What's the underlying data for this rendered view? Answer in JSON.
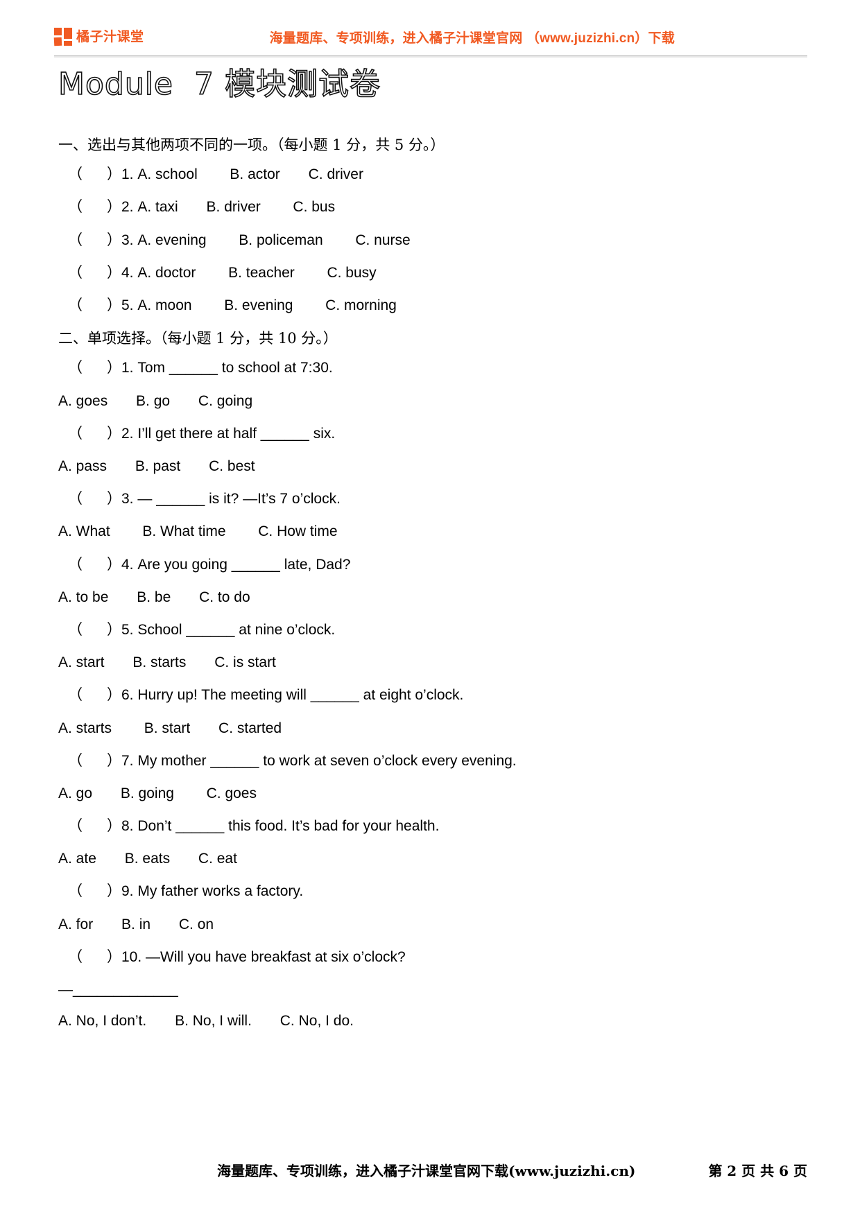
{
  "header": {
    "logo_text": "橘子汁课堂",
    "logo_icon": "orange-squares-logo-icon",
    "slogan": "海量题库、专项训练，进入橘子汁课堂官网 （www.juzizhi.cn）下载",
    "brand_color": "#F15A22"
  },
  "title": "Module  7 模块测试卷",
  "sections": [
    {
      "heading": "一、选出与其他两项不同的一项。（每小题 1 分，共 5 分。）",
      "lines": [
        {
          "type": "question",
          "text": "（      ）1. A. school        B. actor       C. driver"
        },
        {
          "type": "question",
          "text": "（      ）2. A. taxi       B. driver        C. bus"
        },
        {
          "type": "question",
          "text": "（      ）3. A. evening        B. policeman        C. nurse"
        },
        {
          "type": "question",
          "text": "（      ）4. A. doctor        B. teacher        C. busy"
        },
        {
          "type": "question",
          "text": "（      ）5. A. moon        B. evening        C. morning"
        }
      ]
    },
    {
      "heading": "二、单项选择。（每小题 1 分，共 10 分。）",
      "lines": [
        {
          "type": "question",
          "text": "（      ）1. Tom ______ to school at 7:30."
        },
        {
          "type": "options",
          "text": "A. goes       B. go       C. going"
        },
        {
          "type": "question",
          "text": "（      ）2. I’ll get there at half ______ six."
        },
        {
          "type": "options",
          "text": "A. pass       B. past       C. best"
        },
        {
          "type": "question",
          "text": "（      ）3. — ______ is it? —It’s 7 o’clock."
        },
        {
          "type": "options",
          "text": "A. What        B. What time        C. How time"
        },
        {
          "type": "question",
          "text": "（      ）4. Are you going ______ late, Dad?"
        },
        {
          "type": "options",
          "text": "A. to be       B. be       C. to do"
        },
        {
          "type": "question",
          "text": "（      ）5. School ______ at nine o’clock."
        },
        {
          "type": "options",
          "text": "A. start       B. starts       C. is start"
        },
        {
          "type": "question",
          "text": "（      ）6. Hurry up! The meeting will ______ at eight o’clock."
        },
        {
          "type": "options",
          "text": "A. starts        B. start       C. started"
        },
        {
          "type": "question",
          "text": "（      ）7. My mother ______ to work at seven o’clock every evening."
        },
        {
          "type": "options",
          "text": "A. go       B. going        C. goes"
        },
        {
          "type": "question",
          "text": "（      ）8. Don’t ______ this food. It’s bad for your health."
        },
        {
          "type": "options",
          "text": "A. ate       B. eats       C. eat"
        },
        {
          "type": "question",
          "text": "（      ）9. My father works a factory."
        },
        {
          "type": "options",
          "text": "A. for       B. in       C. on"
        },
        {
          "type": "question",
          "text": "（      ）10. —Will you have breakfast at six o’clock?"
        },
        {
          "type": "tail",
          "text": "—_____________"
        },
        {
          "type": "options",
          "text": "A. No, I don’t.       B. No, I will.       C. No, I do."
        }
      ]
    }
  ],
  "footer": {
    "center_text": "海量题库、专项训练，进入橘子汁课堂官网下载(www.juzizhi.cn)",
    "page_text": "第 2 页 共 6 页"
  }
}
